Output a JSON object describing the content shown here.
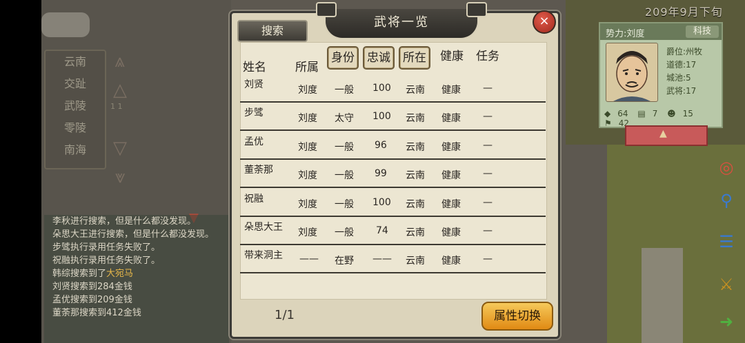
{
  "date": "209年9月下旬",
  "regions": [
    "云南",
    "交趾",
    "武陵",
    "零陵",
    "南海"
  ],
  "region_pager": "1 1",
  "log": [
    {
      "text": "李秋进行搜索，但是什么都没发现。"
    },
    {
      "text": "朵思大王进行搜索，但是什么都没发现。"
    },
    {
      "text": "步骘执行录用任务失败了。"
    },
    {
      "text": "祝融执行录用任务失败了。"
    },
    {
      "text": "韩综搜索到了",
      "highlight": "大宛马"
    },
    {
      "text": "刘贤搜索到284金钱"
    },
    {
      "text": "孟优搜索到209金钱"
    },
    {
      "text": "董荼那搜索到412金钱"
    }
  ],
  "info": {
    "faction": "势力:刘度",
    "tech_button": "科技",
    "rank": "爵位:州牧",
    "virtue": "道德:17",
    "cities": "城池:5",
    "generals": "武将:17",
    "stat1": "64",
    "stat2": "7",
    "stat3": "15",
    "stat4": "42"
  },
  "dialog": {
    "title": "武将一览",
    "search_button": "搜索",
    "close_icon": "×",
    "headers": [
      "姓名",
      "所属",
      "身份",
      "忠诚",
      "所在",
      "健康",
      "任务"
    ],
    "pager": "1/1",
    "switch_button": "属性切换"
  },
  "generals": [
    {
      "name": "刘贤",
      "faction": "刘度",
      "status": "一般",
      "loyalty": "100",
      "location": "云南",
      "health": "健康",
      "task": "—"
    },
    {
      "name": "步骘",
      "faction": "刘度",
      "status": "太守",
      "loyalty": "100",
      "location": "云南",
      "health": "健康",
      "task": "—"
    },
    {
      "name": "孟优",
      "faction": "刘度",
      "status": "一般",
      "loyalty": "96",
      "location": "云南",
      "health": "健康",
      "task": "—"
    },
    {
      "name": "董荼那",
      "faction": "刘度",
      "status": "一般",
      "loyalty": "99",
      "location": "云南",
      "health": "健康",
      "task": "—"
    },
    {
      "name": "祝融",
      "faction": "刘度",
      "status": "一般",
      "loyalty": "100",
      "location": "云南",
      "health": "健康",
      "task": "—"
    },
    {
      "name": "朵思大王",
      "faction": "刘度",
      "status": "一般",
      "loyalty": "74",
      "location": "云南",
      "health": "健康",
      "task": "—"
    },
    {
      "name": "带来洞主",
      "faction": "——",
      "status": "在野",
      "loyalty": "——",
      "location": "云南",
      "health": "健康",
      "task": "—"
    }
  ]
}
